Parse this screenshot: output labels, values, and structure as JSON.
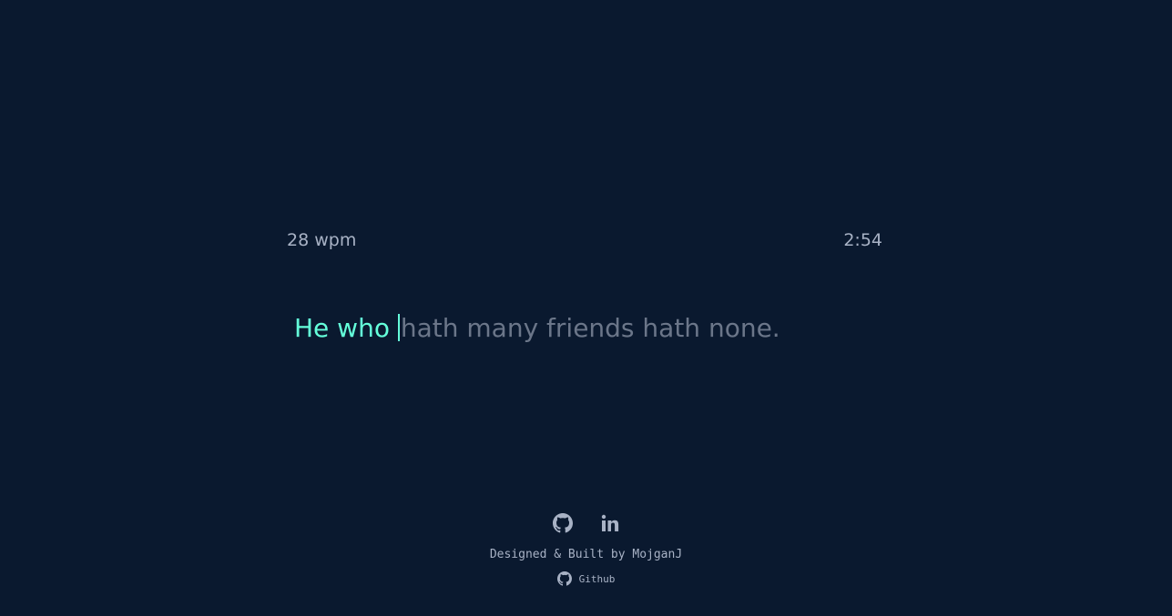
{
  "stats": {
    "wpm": "28 wpm",
    "timer": "2:54"
  },
  "quote": {
    "typed": "He who ",
    "remaining": "hath many friends hath none."
  },
  "footer": {
    "social_icons": [
      "github-icon",
      "linkedin-icon"
    ],
    "credit": "Designed & Built by MojganJ",
    "github_link": "Github"
  },
  "colors": {
    "background": "#0a192f",
    "typed": "#64ffda",
    "remaining": "#6b7689",
    "muted": "#a8b2c5"
  }
}
